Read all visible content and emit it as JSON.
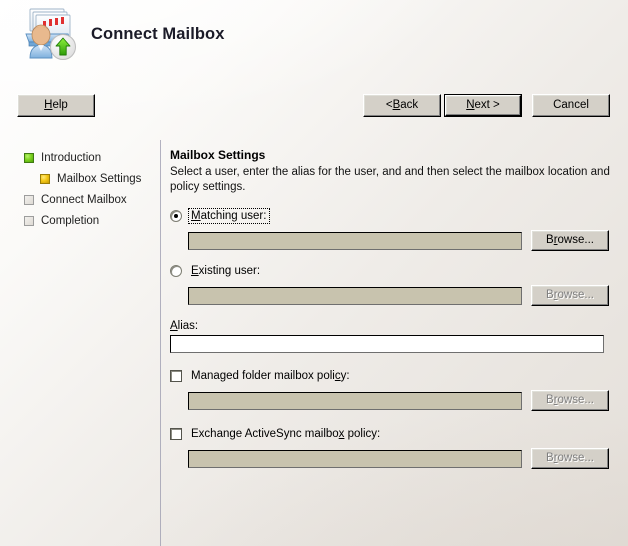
{
  "window": {
    "title": "Connect Mailbox",
    "header_icon": "mailbox-connect-user-icon"
  },
  "sidebar": {
    "steps": [
      {
        "label": "Introduction",
        "state": "done",
        "indent": false
      },
      {
        "label": "Mailbox Settings",
        "state": "current",
        "indent": true
      },
      {
        "label": "Connect Mailbox",
        "state": "pending",
        "indent": false
      },
      {
        "label": "Completion",
        "state": "pending",
        "indent": false
      }
    ]
  },
  "panel": {
    "title": "Mailbox Settings",
    "description": "Select a user, enter the alias for the user, and and then select the mailbox location and policy settings.",
    "matching_user": {
      "label_pre": "M",
      "label_acc": "M",
      "label_rest": "atching user:",
      "label_full": "Matching user:",
      "checked": true,
      "focused": true,
      "value": "",
      "browse_label_pre": "B",
      "browse_label_acc": "r",
      "browse_label_rest": "owse...",
      "browse_label_full": "Browse...",
      "browse_enabled": true
    },
    "existing_user": {
      "label_acc": "E",
      "label_rest": "xisting user:",
      "label_full": "Existing user:",
      "checked": false,
      "value": "",
      "browse_label_full": "Browse...",
      "browse_enabled": false
    },
    "alias": {
      "label_acc": "A",
      "label_rest": "lias:",
      "label_full": "Alias:",
      "value": "",
      "enabled": true
    },
    "managed_folder_policy": {
      "label_pre": "Managed folder mailbox poli",
      "label_acc": "c",
      "label_rest": "y:",
      "label_full": "Managed folder mailbox policy:",
      "checked": false,
      "value": "",
      "browse_label_full": "Browse...",
      "browse_enabled": false
    },
    "activesync_policy": {
      "label_pre": "Exchange ActiveSync mailbo",
      "label_acc": "x",
      "label_rest": " policy:",
      "label_full": "Exchange ActiveSync mailbox policy:",
      "checked": false,
      "value": "",
      "browse_label_full": "Browse...",
      "browse_enabled": false
    }
  },
  "footer": {
    "help": {
      "acc": "H",
      "rest": "elp",
      "full": "Help"
    },
    "back": {
      "pre": "< ",
      "acc": "B",
      "rest": "ack",
      "full": "< Back"
    },
    "next": {
      "acc": "N",
      "rest": "ext >",
      "full": "Next >",
      "is_default": true
    },
    "cancel": {
      "full": "Cancel"
    }
  },
  "colors": {
    "step_done": "#7ed321",
    "step_current": "#f5c816",
    "step_pending": "#dedad4",
    "disabled_field": "#c8c3ae",
    "enabled_field": "#ffffff",
    "divider": "#9a9aae",
    "title_text": "#1b1b28"
  }
}
